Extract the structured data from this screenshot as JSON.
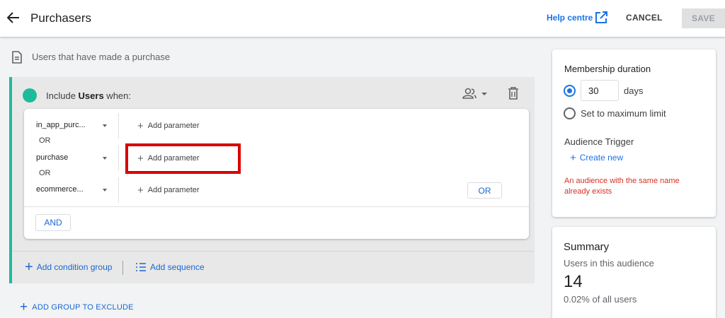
{
  "header": {
    "title": "Purchasers",
    "help_label": "Help centre",
    "cancel_label": "CANCEL",
    "save_label": "SAVE"
  },
  "description": "Users that have made a purchase",
  "include_group": {
    "prefix": "Include ",
    "scope": "Users",
    "suffix": " when:",
    "accent_color": "#1dbb9c",
    "conditions": [
      {
        "event": "in_app_purc...",
        "add_param_label": "Add parameter"
      },
      {
        "event": "purchase",
        "add_param_label": "Add parameter",
        "highlighted": true
      },
      {
        "event": "ecommerce...",
        "add_param_label": "Add parameter"
      }
    ],
    "or_separator": "OR",
    "or_button": "OR",
    "and_button": "AND",
    "add_condition_group": "Add condition group",
    "add_sequence": "Add sequence"
  },
  "add_group_to_exclude": "ADD GROUP TO EXCLUDE",
  "membership": {
    "title": "Membership duration",
    "days_value": "30",
    "days_unit": "days",
    "max_limit_label": "Set to maximum limit",
    "trigger_title": "Audience Trigger",
    "create_new": "Create new",
    "error": "An audience with the same name already exists",
    "selected_option": "days"
  },
  "summary": {
    "title": "Summary",
    "subtitle": "Users in this audience",
    "count": "14",
    "percent": "0.02% of all users"
  },
  "colors": {
    "accent_blue": "#1a73e8",
    "highlight_red": "#d90000",
    "error_red": "#d93025"
  }
}
